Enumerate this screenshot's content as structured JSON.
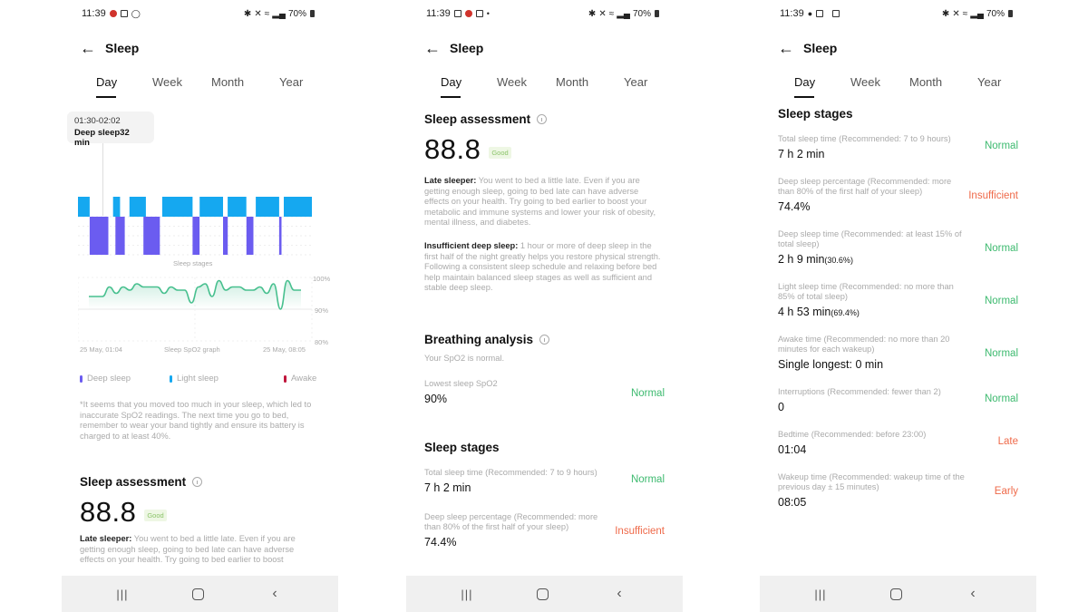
{
  "common": {
    "status_time": "11:39",
    "battery": "70%",
    "app_title": "Sleep",
    "tabs": [
      "Day",
      "Week",
      "Month",
      "Year"
    ],
    "active_tab": "Day"
  },
  "panel1": {
    "status_icons": [
      "red-app-icon",
      "notification-icon",
      "whatsapp-icon"
    ],
    "tooltip": {
      "range": "01:30-02:02",
      "detail": "Deep sleep32 min"
    },
    "stages_caption": "Sleep stages",
    "spo2": {
      "caption": "Sleep SpO2 graph",
      "start_label": "25 May, 01:04",
      "end_label": "25 May, 08:05",
      "y_ticks": [
        "100%",
        "90%",
        "80%"
      ]
    },
    "legend": [
      {
        "label": "Deep sleep",
        "color": "#6b5cf0"
      },
      {
        "label": "Light sleep",
        "color": "#15a8f0"
      },
      {
        "label": "Awake",
        "color": "#c0163c"
      }
    ],
    "warning": "*It seems that you moved too much in your sleep, which led to inaccurate SpO2 readings. The next time you go to bed, remember to wear your band tightly and ensure its battery is charged to at least 40%.",
    "assessment": {
      "title": "Sleep assessment",
      "score": "88.8",
      "badge": "Good",
      "late_label": "Late sleeper:",
      "late_text": " You went to bed a little late. Even if you are getting enough sleep, going to bed late can have adverse effects on your health. Try going to bed earlier to boost"
    }
  },
  "panel2": {
    "status_icons": [
      "calendar-icon",
      "red-app-icon",
      "gallery-icon",
      "dot-icon"
    ],
    "assessment": {
      "title": "Sleep assessment",
      "score": "88.8",
      "badge": "Good",
      "late_label": "Late sleeper:",
      "late_text": " You went to bed a little late. Even if you are getting enough sleep, going to bed late can have adverse effects on your health. Try going to bed earlier to boost your metabolic and immune systems and lower your risk of obesity, mental illness, and diabetes.",
      "deep_label": "Insufficient deep sleep:",
      "deep_text": " 1 hour or more of deep sleep in the first half of the night greatly helps you restore physical strength. Following a consistent sleep schedule and relaxing before bed help maintain balanced sleep stages as well as sufficient and stable deep sleep."
    },
    "breathing": {
      "title": "Breathing analysis",
      "summary": "Your SpO2 is normal.",
      "lowest_label": "Lowest sleep SpO2",
      "lowest_value": "90%",
      "lowest_status": "Normal"
    },
    "stages_title": "Sleep stages",
    "stages": [
      {
        "label": "Total sleep time (Recommended: 7 to 9 hours)",
        "value": "7 h 2 min",
        "status": "Normal",
        "tone": "green"
      },
      {
        "label": "Deep sleep percentage (Recommended: more than 80% of the first half of your sleep)",
        "value": "74.4%",
        "status": "Insufficient",
        "tone": "orange"
      }
    ]
  },
  "panel3": {
    "status_icons": [
      "location-icon",
      "gallery-icon",
      "cast-icon"
    ],
    "stages_title": "Sleep stages",
    "stages": [
      {
        "label": "Total sleep time (Recommended: 7 to 9 hours)",
        "value": "7 h 2 min",
        "extra": "",
        "status": "Normal",
        "tone": "green"
      },
      {
        "label": "Deep sleep percentage (Recommended: more than 80% of the first half of your sleep)",
        "value": "74.4%",
        "extra": "",
        "status": "Insufficient",
        "tone": "orange"
      },
      {
        "label": "Deep sleep time (Recommended: at least 15% of total sleep)",
        "value": "2 h 9 min",
        "extra": "(30.6%)",
        "status": "Normal",
        "tone": "green"
      },
      {
        "label": "Light sleep time (Recommended: no more than 85% of total sleep)",
        "value": "4 h 53 min",
        "extra": "(69.4%)",
        "status": "Normal",
        "tone": "green"
      },
      {
        "label": "Awake time (Recommended: no more than 20 minutes for each wakeup)",
        "value": "Single longest: 0 min",
        "extra": "",
        "status": "Normal",
        "tone": "green"
      },
      {
        "label": "Interruptions (Recommended: fewer than 2)",
        "value": "0",
        "extra": "",
        "status": "Normal",
        "tone": "green"
      },
      {
        "label": "Bedtime (Recommended: before 23:00)",
        "value": "01:04",
        "extra": "",
        "status": "Late",
        "tone": "orange"
      },
      {
        "label": "Wakeup time (Recommended: wakeup time of the previous day ± 15 minutes)",
        "value": "08:05",
        "extra": "",
        "status": "Early",
        "tone": "orange"
      }
    ]
  },
  "chart_data": [
    {
      "type": "bar",
      "title": "Sleep stages",
      "x_range": [
        "01:04",
        "08:05"
      ],
      "series": [
        {
          "name": "Light sleep",
          "color": "#15a8f0",
          "segments": [
            [
              0.0,
              0.05
            ],
            [
              0.15,
              0.18
            ],
            [
              0.22,
              0.29
            ],
            [
              0.36,
              0.49
            ],
            [
              0.52,
              0.62
            ],
            [
              0.64,
              0.72
            ],
            [
              0.76,
              0.86
            ],
            [
              0.88,
              1.0
            ]
          ]
        },
        {
          "name": "Deep sleep",
          "color": "#6b5cf0",
          "segments": [
            [
              0.05,
              0.13
            ],
            [
              0.16,
              0.2
            ],
            [
              0.28,
              0.35
            ],
            [
              0.49,
              0.52
            ],
            [
              0.62,
              0.64
            ],
            [
              0.72,
              0.75
            ],
            [
              0.86,
              0.87
            ]
          ]
        }
      ]
    },
    {
      "type": "line",
      "title": "Sleep SpO2 graph",
      "xlabel_start": "25 May, 01:04",
      "xlabel_end": "25 May, 08:05",
      "ylim": [
        80,
        100
      ],
      "y_ticks": [
        100,
        90,
        80
      ],
      "values": [
        94,
        94,
        94,
        97,
        95,
        97,
        96,
        98,
        97,
        97,
        97,
        95,
        97,
        96,
        96,
        92,
        97,
        98,
        94,
        99,
        96,
        97,
        97,
        96,
        96,
        97,
        95,
        98,
        90,
        99,
        96,
        96
      ]
    }
  ]
}
